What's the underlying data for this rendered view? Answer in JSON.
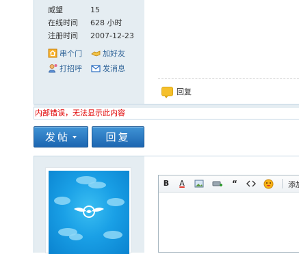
{
  "profile": {
    "stats": [
      {
        "key": "威望",
        "value": "15"
      },
      {
        "key": "在线时间",
        "value": "628 小时"
      },
      {
        "key": "注册时间",
        "value": "2007-12-23"
      }
    ],
    "actions": {
      "visit": "串个门",
      "add_friend": "加好友",
      "greet": "打招呼",
      "message": "发消息"
    }
  },
  "post": {
    "reply_label": "回复"
  },
  "error_message": "内部错误，无法显示此内容",
  "buttons": {
    "post_label": "发帖",
    "reply_label": "回复"
  },
  "editor": {
    "toolbar_more": "添加"
  },
  "colors": {
    "button_blue": "#2A7BC4",
    "sidebar_bg": "#E5EDF2",
    "error_red": "#E00000",
    "link_blue": "#336699"
  }
}
